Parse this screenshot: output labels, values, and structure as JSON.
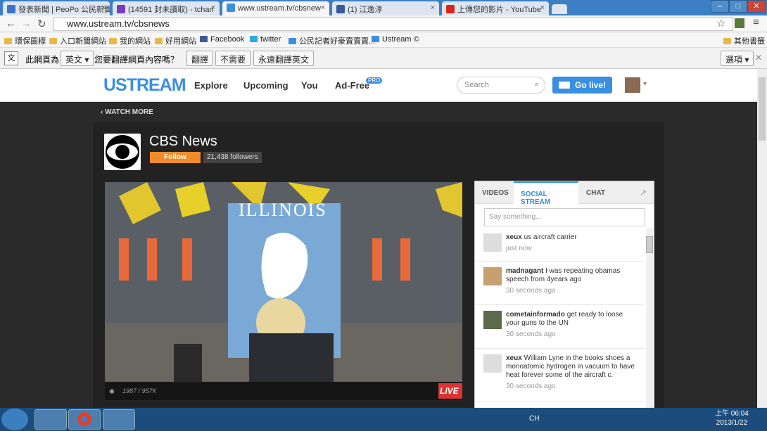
{
  "tabs": [
    {
      "title": "發表新聞 | PeoPo 公民新聞",
      "color": "#3b74c7"
    },
    {
      "title": "(14591 封未讀取) - tchan",
      "color": "#7b3bb1"
    },
    {
      "title": "www.ustream.tv/cbsnew",
      "color": "#3a8fe0"
    },
    {
      "title": "(1) 江逸淳",
      "color": "#3b5998"
    },
    {
      "title": "上傳您的影片 - YouTube",
      "color": "#d9251c"
    }
  ],
  "url": "www.ustream.tv/cbsnews",
  "bookmarks": [
    "環保圖標",
    "入口新聞網站",
    "我的網站",
    "好用網站",
    "Facebook",
    "twitter",
    "公民記者好豪賣賣賣...",
    "Ustream ©",
    "其他書籤"
  ],
  "translate": {
    "label": "此網頁為",
    "lang": "英文",
    "question": "您要翻譯網頁內容嗎？",
    "translate": "翻譯",
    "no": "不需要",
    "always": "永遠翻譯英文",
    "options": "選項"
  },
  "header": {
    "logo": "USTREAM",
    "nav": [
      "Explore",
      "Upcoming",
      "You",
      "Ad-Free"
    ],
    "pro": "PRO",
    "search": "Search",
    "golive": "Go live!"
  },
  "watchmore": "WATCH MORE",
  "channel": {
    "name": "CBS News",
    "follow": "Follow",
    "followers": "21,438 followers"
  },
  "video": {
    "views": "1987 / 957K",
    "live": "LIVE",
    "banner": "ILLINOIS"
  },
  "panel": {
    "tabs": [
      "VIDEOS",
      "SOCIAL STREAM",
      "CHAT"
    ],
    "say": "Say something...",
    "messages": [
      {
        "user": "xeux",
        "text": "us aircraft carrier",
        "time": "just now"
      },
      {
        "user": "madnagant",
        "text": "I was repeating obamas speech from 4years ago",
        "time": "30 seconds ago"
      },
      {
        "user": "cometainformado",
        "text": "get ready to loose your guns to the UN",
        "time": "30 seconds ago"
      },
      {
        "user": "xeux",
        "text": "William Lyne in the books shoes a monoatomic hydrogen in vacuum to have heat forever some of the aircraft c.",
        "time": "30 seconds ago"
      }
    ]
  },
  "clock": {
    "time": "上午 06:04",
    "date": "2013/1/22",
    "lang": "CH"
  }
}
